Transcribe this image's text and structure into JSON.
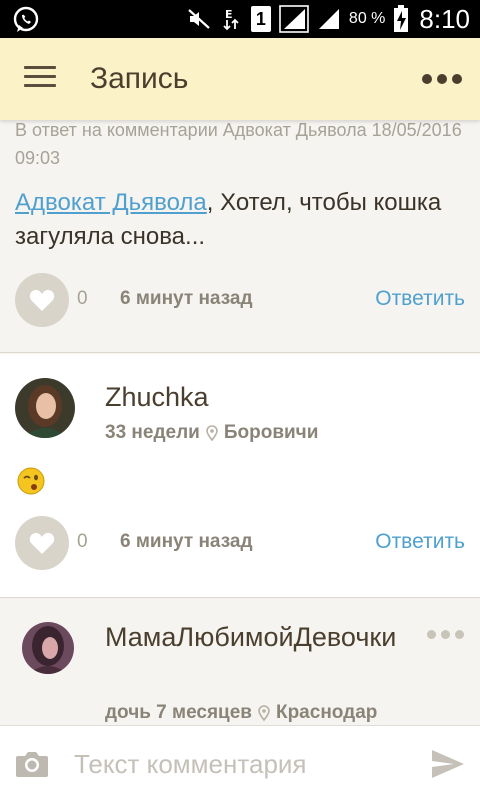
{
  "status_bar": {
    "battery_percent": "80 %",
    "sim_label": "1",
    "time": "8:10"
  },
  "app_bar": {
    "title": "Запись"
  },
  "comments": [
    {
      "reply_to": "В ответ на комментарии Адвокат Дьявола 18/05/2016 09:03",
      "mention": "Адвокат Дьявола",
      "text": ", Хотел, чтобы кошка загуляла снова...",
      "like_count": "0",
      "time_ago": "6 минут назад",
      "reply_label": "Ответить"
    },
    {
      "author": "Zhuchka",
      "age": "33 недели",
      "city": "Боровичи",
      "emoji": "winking-face",
      "like_count": "0",
      "time_ago": "6 минут назад",
      "reply_label": "Ответить"
    },
    {
      "author": "МамаЛюбимойДевочки",
      "age": "дочь 7 месяцев",
      "city": "Краснодар"
    }
  ],
  "input_bar": {
    "placeholder": "Текст комментария"
  },
  "colors": {
    "app_bar_bg": "#fcf2c8",
    "accent_link": "#4fa0cf",
    "text_primary": "#3b3327"
  }
}
